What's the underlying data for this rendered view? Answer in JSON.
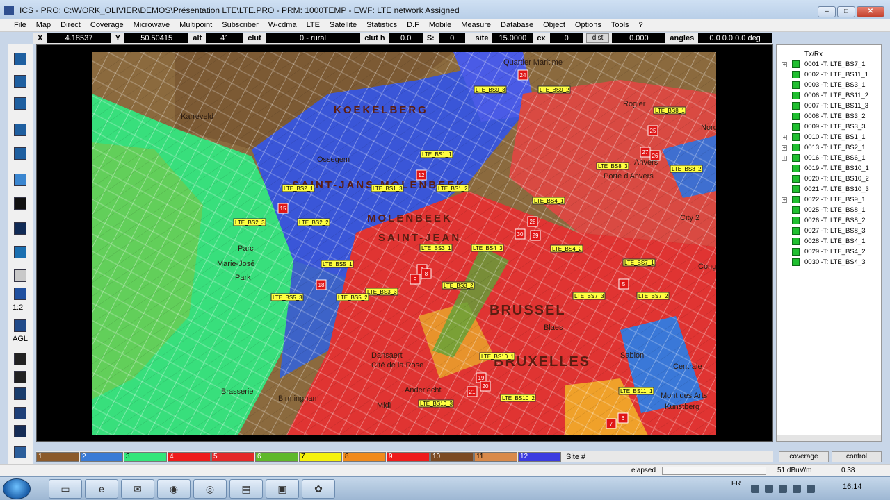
{
  "title": "ICS - PRO: C:\\WORK_OLIVIER\\DEMOS\\Présentation LTE\\LTE.PRO - PRM: 1000TEMP - EWF: LTE network Assigned",
  "menu": [
    "File",
    "Map",
    "Direct",
    "Coverage",
    "Microwave",
    "Multipoint",
    "Subscriber",
    "W-cdma",
    "LTE",
    "Satellite",
    "Statistics",
    "D.F",
    "Mobile",
    "Measure",
    "Database",
    "Object",
    "Options",
    "Tools",
    "?"
  ],
  "coords": {
    "x_label": "X",
    "x_value": "4.18537",
    "y_label": "Y",
    "y_value": "50.50415",
    "alt_label": "alt",
    "alt_value": "41",
    "clut_label": "clut",
    "clut_value": "0 - rural",
    "cluth_label": "clut h",
    "cluth_value": "0.0",
    "s_label": "S:",
    "s_value": "0",
    "site_label": "site",
    "site_value": "15.0000",
    "cx_label": "cx",
    "cx_value": "0",
    "dist_button": "dist",
    "dist_value": "0.000",
    "angles_label": "angles",
    "angles_value": "0.0 0.0 0.0 deg"
  },
  "lefttools": {
    "ratio": "1:2",
    "agl": "AGL"
  },
  "map": {
    "place_labels": [
      "KOEKELBERG",
      "SAINT-JANS-MOLENBEEK",
      "MOLENBEEK",
      "SAINT-JEAN",
      "BRUSSEL",
      "BRUXELLES",
      "Quartier Maritime",
      "Birmingham",
      "Karreveld",
      "Ossegem",
      "Anderlecht",
      "Parc",
      "Marie-José",
      "Park",
      "Nord",
      "Rogier",
      "Anvers",
      "City 2",
      "Congres",
      "Blaes",
      "Midi",
      "Sablon",
      "Mont des Arts",
      "Kunstberg",
      "Centrale",
      "Cité de la Rose",
      "Brasserie",
      "Dansaert",
      "Porte d'Anvers"
    ],
    "cell_labels": [
      "LTE_BS9_3",
      "LTE_BS9_2",
      "LTE_BS8_1",
      "LTE_BS1_1",
      "LTE_BS2_1",
      "LTE_BS1_3",
      "LTE_BS1_2",
      "LTE_BS8_3",
      "LTE_BS8_2",
      "LTE_BS4_1",
      "LTE_BS2_3",
      "LTE_BS2_2",
      "LTE_BS3_1",
      "LTE_BS4_3",
      "LTE_BS4_2",
      "LTE_BS5_1",
      "LTE_BS3_2",
      "LTE_BS3_3",
      "LTE_BS5_3",
      "LTE_BS5_2",
      "LTE_BS7_1",
      "LTE_BS7_3",
      "LTE_BS7_2",
      "LTE_BS10_1",
      "LTE_BS10_3",
      "LTE_BS10_2",
      "LTE_BS11_1"
    ],
    "site_markers": [
      "24",
      "25",
      "26",
      "27",
      "12",
      "15",
      "28",
      "29",
      "30",
      "7",
      "9",
      "8",
      "18",
      "5",
      "19",
      "20",
      "21",
      "6",
      "7"
    ]
  },
  "rightpanel": {
    "header": "Tx/Rx",
    "items": [
      {
        "label": "0001 -T: LTE_BS7_1",
        "plus": true
      },
      {
        "label": "0002 -T: LTE_BS11_1",
        "plus": false
      },
      {
        "label": "0003 -T: LTE_BS3_1",
        "plus": false
      },
      {
        "label": "0006 -T: LTE_BS11_2",
        "plus": false
      },
      {
        "label": "0007 -T: LTE_BS11_3",
        "plus": false
      },
      {
        "label": "0008 -T: LTE_BS3_2",
        "plus": false
      },
      {
        "label": "0009 -T: LTE_BS3_3",
        "plus": false
      },
      {
        "label": "0010 -T: LTE_BS1_1",
        "plus": true
      },
      {
        "label": "0013 -T: LTE_BS2_1",
        "plus": true
      },
      {
        "label": "0016 -T: LTE_BS6_1",
        "plus": true
      },
      {
        "label": "0019 -T: LTE_BS10_1",
        "plus": false
      },
      {
        "label": "0020 -T: LTE_BS10_2",
        "plus": false
      },
      {
        "label": "0021 -T: LTE_BS10_3",
        "plus": false
      },
      {
        "label": "0022 -T: LTE_BS9_1",
        "plus": true
      },
      {
        "label": "0025 -T: LTE_BS8_1",
        "plus": false
      },
      {
        "label": "0026 -T: LTE_BS8_2",
        "plus": false
      },
      {
        "label": "0027 -T: LTE_BS8_3",
        "plus": false
      },
      {
        "label": "0028 -T: LTE_BS4_1",
        "plus": false
      },
      {
        "label": "0029 -T: LTE_BS4_2",
        "plus": false
      },
      {
        "label": "0030 -T: LTE_BS4_3",
        "plus": false
      }
    ]
  },
  "legend": {
    "cells": [
      {
        "label": "1",
        "color": "#8b5a2b"
      },
      {
        "label": "2",
        "color": "#3a7bd5"
      },
      {
        "label": "3",
        "color": "#33e67a"
      },
      {
        "label": "4",
        "color": "#ee1b1b"
      },
      {
        "label": "5",
        "color": "#e42828"
      },
      {
        "label": "6",
        "color": "#5fb82a"
      },
      {
        "label": "7",
        "color": "#f6f20c"
      },
      {
        "label": "8",
        "color": "#f08a1c"
      },
      {
        "label": "9",
        "color": "#ee1b1b"
      },
      {
        "label": "10",
        "color": "#7c4a22"
      },
      {
        "label": "11",
        "color": "#d98a4a"
      },
      {
        "label": "12",
        "color": "#3b3be0"
      }
    ],
    "site_label": "Site #"
  },
  "buttons": {
    "coverage": "coverage",
    "control": "control"
  },
  "status": {
    "elapsed": "elapsed",
    "unit": "51 dBuV/m",
    "value": "0.38"
  },
  "taskbar": {
    "lang": "FR",
    "time": "16:14"
  }
}
